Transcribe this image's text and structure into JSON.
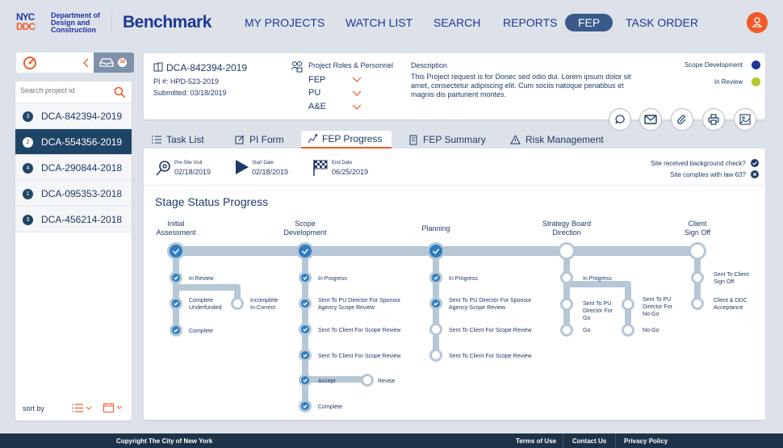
{
  "header": {
    "logo_top": "NYC",
    "logo_bottom": "DDC",
    "department": "Department of Design and Construction",
    "brand": "Benchmark",
    "nav": [
      "MY PROJECTS",
      "WATCH LIST",
      "SEARCH",
      "REPORTS",
      "FEP",
      "TASK ORDER"
    ],
    "active_nav": "FEP",
    "user_icon": "user-icon"
  },
  "sidebar": {
    "inbox_count": "38",
    "search_placeholder": "Search project id",
    "projects": [
      {
        "count": "3",
        "id": "DCA-842394-2019",
        "selected": false
      },
      {
        "count": "2",
        "id": "DCA-554356-2019",
        "selected": true
      },
      {
        "count": "4",
        "id": "DCA-290844-2018",
        "selected": false
      },
      {
        "count": "1",
        "id": "DCA-095353-2018",
        "selected": false
      },
      {
        "count": "3",
        "id": "DCA-456214-2018",
        "selected": false
      }
    ],
    "sort_label": "sort by"
  },
  "project": {
    "id": "DCA-842394-2019",
    "pi": "PI #: HPD-523-2019",
    "submitted": "Submitted: 03/18/2019",
    "roles_title": "Project Roles & Personnel",
    "roles": [
      "FEP",
      "PU",
      "A&E"
    ],
    "description_label": "Description",
    "description": "This Project request is for Donec sed odio dui. Lorem ipsum dolor sit amet, consectetur adipiscing elit. Cum sociis natoque penatibus et magnis dis parturient montes.",
    "statuses": [
      {
        "label": "Scope Development",
        "color": "#1d3795"
      },
      {
        "label": "In Review",
        "color": "#b5c72a"
      }
    ]
  },
  "actions": [
    "comment-icon",
    "mail-icon",
    "attach-icon",
    "print-icon",
    "image-icon"
  ],
  "tabs": [
    {
      "label": "Task List",
      "icon": "list-icon"
    },
    {
      "label": "PI Form",
      "icon": "edit-icon"
    },
    {
      "label": "FEP Progress",
      "icon": "progress-icon",
      "active": true
    },
    {
      "label": "FEP Summary",
      "icon": "summary-icon"
    },
    {
      "label": "Risk Management",
      "icon": "warning-icon"
    }
  ],
  "dates": {
    "pre_site_label": "Pre-Site Visit",
    "pre_site": "02/18/2019",
    "start_label": "Start Date",
    "start": "02/18/2019",
    "end_label": "End Date",
    "end": "06/25/2019"
  },
  "checks": [
    {
      "label": "Site received background check?",
      "state": "yes"
    },
    {
      "label": "Site complies with law 63?",
      "state": "no"
    }
  ],
  "progress": {
    "title": "Stage Status Progress",
    "stages": [
      {
        "label": "Initial\nAssessment",
        "done": true
      },
      {
        "label": "Scope\nDevelopment",
        "done": true
      },
      {
        "label": "Planning",
        "done": true
      },
      {
        "label": "Strategy Board\nDirection",
        "done": false
      },
      {
        "label": "Client\nSign Off",
        "done": false
      }
    ],
    "steps": {
      "s0": [
        {
          "label": "In Review",
          "done": true
        },
        {
          "label": "Complete\nUnderfunded",
          "done": true
        },
        {
          "label": "Complete",
          "done": true
        },
        {
          "label": "Incomplete\nIn-Correct",
          "done": false
        }
      ],
      "s1": [
        {
          "label": "In Progress",
          "done": true
        },
        {
          "label": "Sent To PU Director For Sponsor\nAgency Scope Review",
          "done": true
        },
        {
          "label": "Sent To Client For Scope Review",
          "done": true
        },
        {
          "label": "Sent To Client For Scope Review",
          "done": true
        },
        {
          "label": "Accept",
          "done": true
        },
        {
          "label": "Complete",
          "done": true
        },
        {
          "label": "Revise",
          "done": false
        }
      ],
      "s2": [
        {
          "label": "In Progress",
          "done": true
        },
        {
          "label": "Sent To PU Director For Sponsor\nAgency Scope Review",
          "done": true
        },
        {
          "label": "Sent To Client For Scope Review",
          "done": false
        },
        {
          "label": "Sent To Client For Scope Review",
          "done": false
        }
      ],
      "s3": [
        {
          "label": "In Progress",
          "done": false
        },
        {
          "label": "Sent To PU\nDirector For\nGo",
          "done": false
        },
        {
          "label": "Go",
          "done": false
        },
        {
          "label": "Sent To PU\nDirector For\nNo-Go",
          "done": false
        },
        {
          "label": "No-Go",
          "done": false
        }
      ],
      "s4": [
        {
          "label": "Sent To Client\nSign Off",
          "done": false
        },
        {
          "label": "Client & DDC\nAcceptance",
          "done": false
        }
      ]
    }
  },
  "footer": {
    "copyright": "Copyright The City of New York",
    "links": [
      "Terms of Use",
      "Contact Us",
      "Privacy Policy"
    ]
  }
}
